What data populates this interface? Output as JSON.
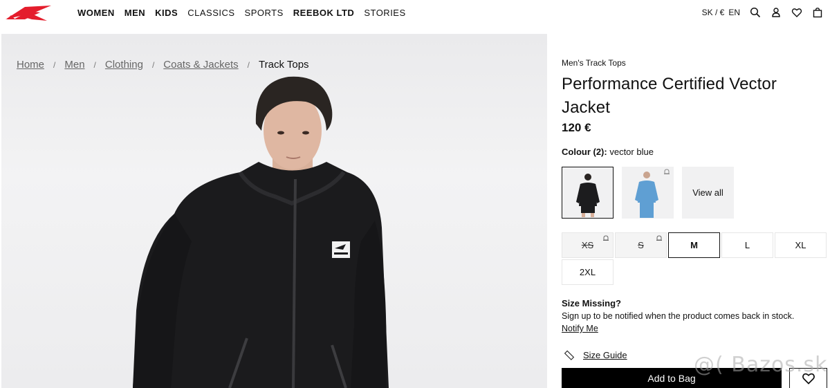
{
  "brand": {
    "logo_icon": "reebok-vector-logo",
    "accent": "#e41d2c"
  },
  "nav": {
    "items": [
      {
        "label": "WOMEN",
        "bold": true
      },
      {
        "label": "MEN",
        "bold": true
      },
      {
        "label": "KIDS",
        "bold": true
      },
      {
        "label": "CLASSICS",
        "bold": false
      },
      {
        "label": "SPORTS",
        "bold": false
      },
      {
        "label": "REEBOK LTD",
        "bold": true
      },
      {
        "label": "STORIES",
        "bold": false
      }
    ]
  },
  "util": {
    "region": "SK / €",
    "language": "EN"
  },
  "breadcrumb": [
    "Home",
    "Men",
    "Clothing",
    "Coats & Jackets",
    "Track Tops"
  ],
  "product": {
    "category": "Men's Track Tops",
    "title": "Performance Certified Vector Jacket",
    "price": "120 €",
    "colour_label": "Colour (2):",
    "colour_value": "vector blue",
    "view_all": "View all",
    "jacket_colors": {
      "black": "#1c1c1e",
      "blue": "#5f9fd3"
    }
  },
  "sizes": [
    {
      "label": "XS",
      "available": false
    },
    {
      "label": "S",
      "available": false
    },
    {
      "label": "M",
      "available": true,
      "selected": true
    },
    {
      "label": "L",
      "available": true
    },
    {
      "label": "XL",
      "available": true
    },
    {
      "label": "2XL",
      "available": true
    }
  ],
  "size_missing": {
    "heading": "Size Missing?",
    "text": "Sign up to be notified when the product comes back in stock.",
    "link": "Notify Me"
  },
  "size_guide": "Size Guide",
  "add_to_bag": "Add to Bag",
  "watermark": "@( Bazos.sk"
}
